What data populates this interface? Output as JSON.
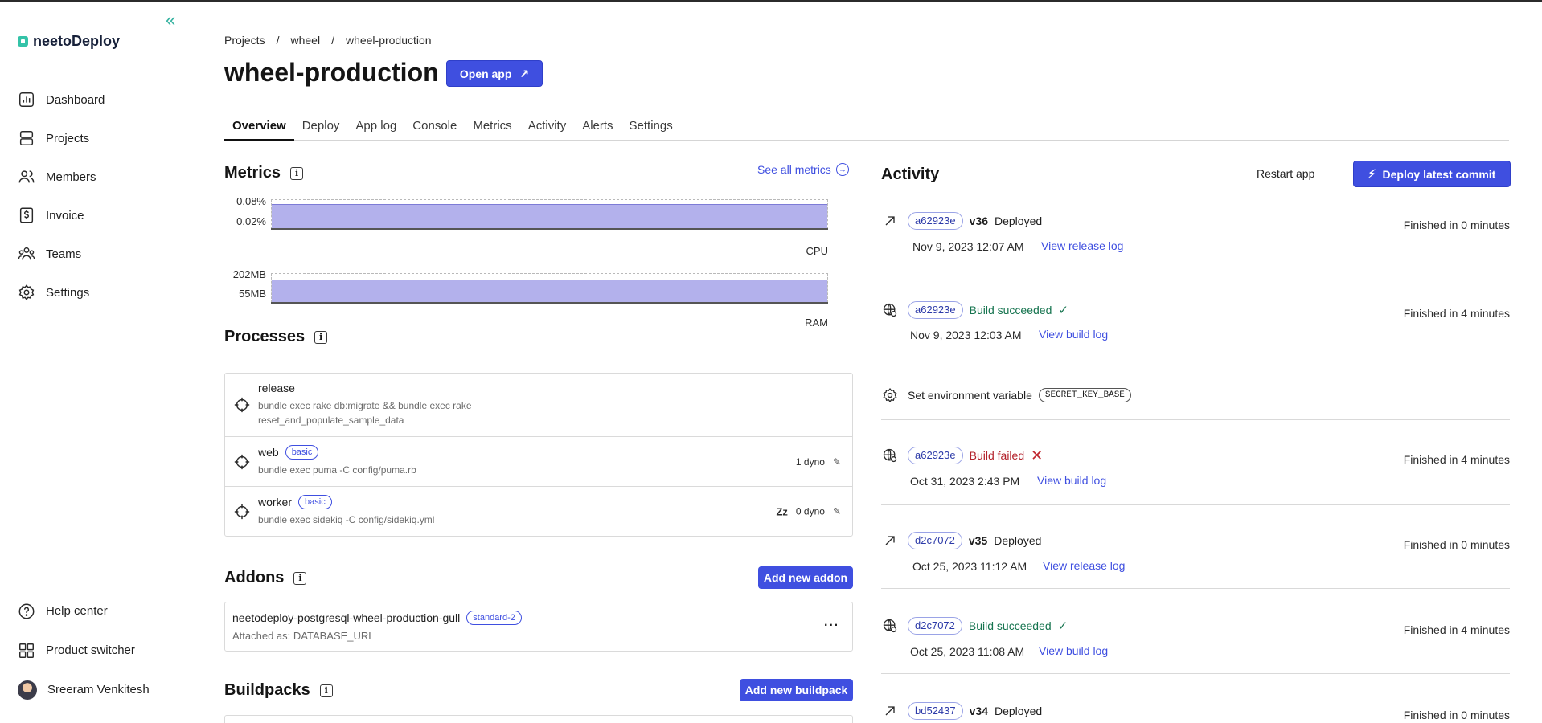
{
  "app": {
    "logo_text": "neetoDeploy"
  },
  "sidebar": {
    "items": [
      {
        "label": "Dashboard",
        "icon": "dashboard-icon"
      },
      {
        "label": "Projects",
        "icon": "projects-icon"
      },
      {
        "label": "Members",
        "icon": "members-icon"
      },
      {
        "label": "Invoice",
        "icon": "invoice-icon"
      },
      {
        "label": "Teams",
        "icon": "teams-icon"
      },
      {
        "label": "Settings",
        "icon": "settings-icon"
      }
    ],
    "bottom": {
      "help": "Help center",
      "switcher": "Product switcher",
      "user": "Sreeram Venkitesh"
    }
  },
  "breadcrumb": {
    "projects": "Projects",
    "sep": "/",
    "project": "wheel",
    "app": "wheel-production"
  },
  "page": {
    "title": "wheel-production",
    "open_app": "Open app"
  },
  "tabs": [
    "Overview",
    "Deploy",
    "App log",
    "Console",
    "Metrics",
    "Activity",
    "Alerts",
    "Settings"
  ],
  "metrics": {
    "title": "Metrics",
    "see_all": "See all metrics",
    "cpu": {
      "label": "CPU",
      "ticks": [
        "0.08%",
        "0.02%"
      ]
    },
    "ram": {
      "label": "RAM",
      "ticks": [
        "202MB",
        "55MB"
      ]
    }
  },
  "processes": {
    "title": "Processes",
    "items": [
      {
        "name": "release",
        "badge": "",
        "cmd": "bundle exec rake db:migrate && bundle exec rake",
        "cmd2": "reset_and_populate_sample_data",
        "dyno": ""
      },
      {
        "name": "web",
        "badge": "basic",
        "cmd": "bundle exec puma -C config/puma.rb",
        "dyno": "1 dyno"
      },
      {
        "name": "worker",
        "badge": "basic",
        "cmd": "bundle exec sidekiq -C config/sidekiq.yml",
        "dyno": "0 dyno",
        "sleep": "Zz"
      }
    ]
  },
  "addons": {
    "title": "Addons",
    "add_label": "Add new addon",
    "item": {
      "name": "neetodeploy-postgresql-wheel-production-gull",
      "badge": "standard-2",
      "attached": "Attached as: DATABASE_URL",
      "more": "···"
    }
  },
  "buildpacks": {
    "title": "Buildpacks",
    "add_label": "Add new buildpack"
  },
  "activity": {
    "title": "Activity",
    "restart": "Restart app",
    "deploy_latest": "Deploy latest commit",
    "items": [
      {
        "commit": "a62923e",
        "version": "v36",
        "status": "Deployed",
        "date": "Nov 9, 2023 12:07 AM",
        "link": "View release log",
        "finished": "Finished in 0 minutes"
      },
      {
        "commit": "a62923e",
        "status": "Build succeeded",
        "date": "Nov 9, 2023 12:03 AM",
        "link": "View build log",
        "finished": "Finished in 4 minutes"
      },
      {
        "status": "Set environment variable",
        "env": "SECRET_KEY_BASE"
      },
      {
        "commit": "a62923e",
        "status": "Build failed",
        "date": "Oct 31, 2023 2:43 PM",
        "link": "View build log",
        "finished": "Finished in 4 minutes"
      },
      {
        "commit": "d2c7072",
        "version": "v35",
        "status": "Deployed",
        "date": "Oct 25, 2023 11:12 AM",
        "link": "View release log",
        "finished": "Finished in 0 minutes"
      },
      {
        "commit": "d2c7072",
        "status": "Build succeeded",
        "date": "Oct 25, 2023 11:08 AM",
        "link": "View build log",
        "finished": "Finished in 4 minutes"
      },
      {
        "commit": "bd52437",
        "version": "v34",
        "status": "Deployed",
        "finished": "Finished in 0 minutes"
      }
    ]
  },
  "colors": {
    "accent": "#3f4fe0",
    "brand": "#34c3a8",
    "success": "#16744f",
    "danger": "#b3202a",
    "chart_fill": "#b3b1ec"
  }
}
